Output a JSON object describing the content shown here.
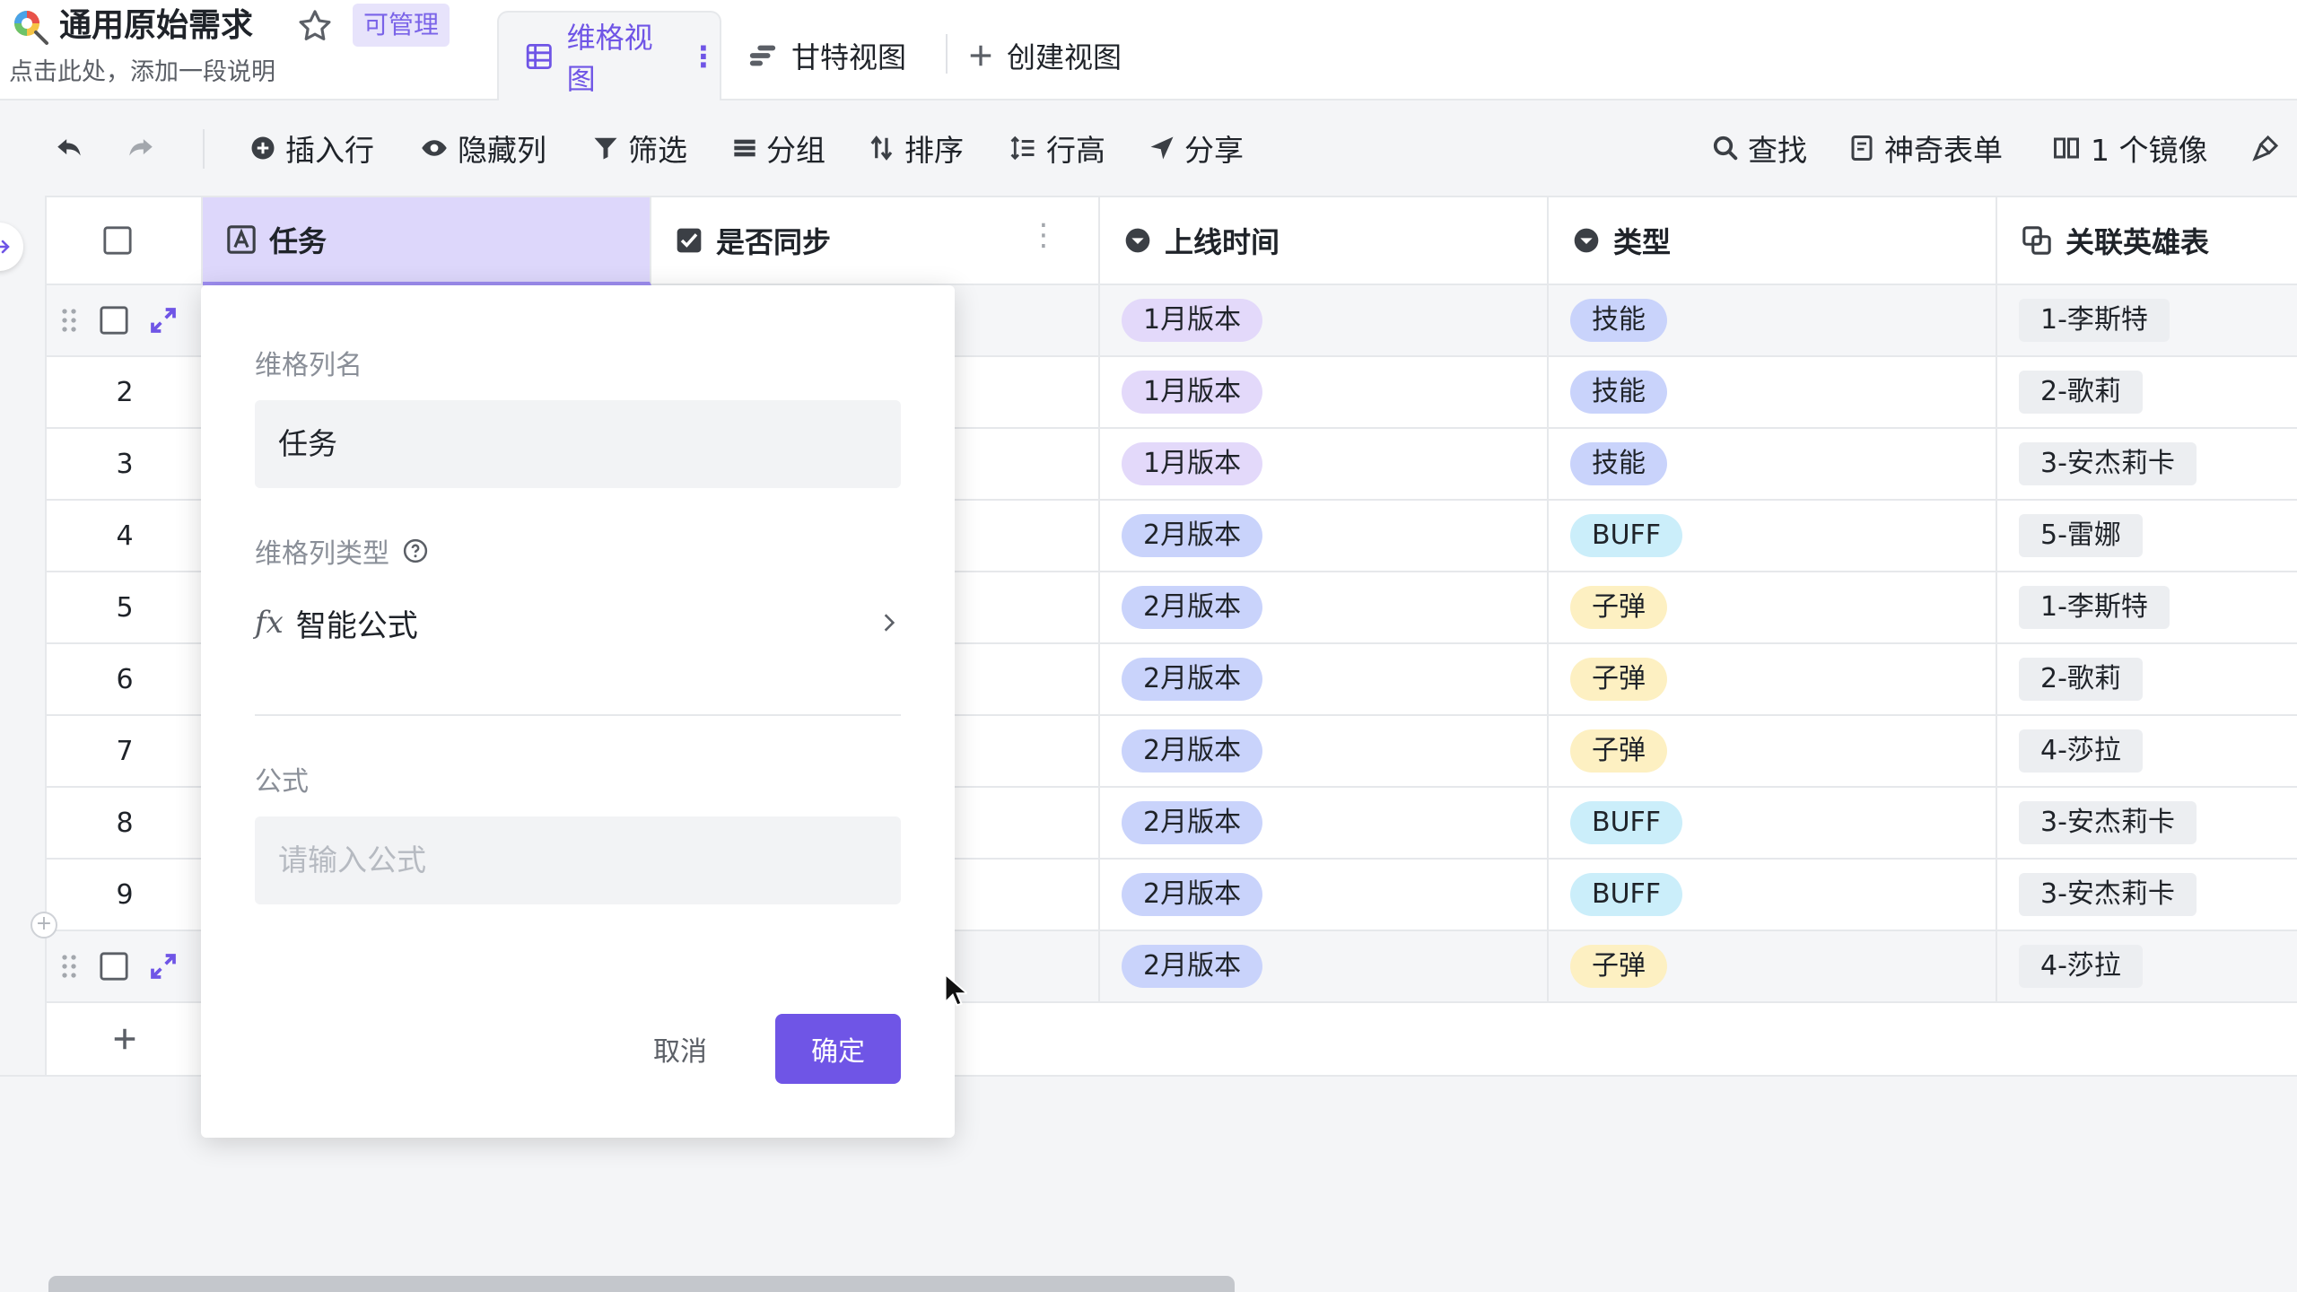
{
  "header": {
    "title": "通用原始需求",
    "permission": "可管理",
    "description": "点击此处，添加一段说明",
    "views": [
      {
        "label": "维格视图",
        "active": true
      },
      {
        "label": "甘特视图",
        "active": false
      },
      {
        "label": "创建视图",
        "active": false
      }
    ]
  },
  "toolbar": {
    "insert_row": "插入行",
    "hide_columns": "隐藏列",
    "filter": "筛选",
    "group": "分组",
    "sort": "排序",
    "row_height": "行高",
    "share": "分享",
    "find": "查找",
    "magic_form": "神奇表单",
    "mirror": "1 个镜像"
  },
  "columns": [
    {
      "name": "任务",
      "icon": "text-icon"
    },
    {
      "name": "是否同步",
      "icon": "checkbox-icon"
    },
    {
      "name": "上线时间",
      "icon": "single-select-icon"
    },
    {
      "name": "类型",
      "icon": "single-select-icon"
    },
    {
      "name": "关联英雄表",
      "icon": "link-icon"
    }
  ],
  "rows": [
    {
      "num": "",
      "release": "1月版本",
      "type": "技能",
      "hero": "1-李斯特"
    },
    {
      "num": "2",
      "release": "1月版本",
      "type": "技能",
      "hero": "2-歌莉"
    },
    {
      "num": "3",
      "release": "1月版本",
      "type": "技能",
      "hero": "3-安杰莉卡"
    },
    {
      "num": "4",
      "release": "2月版本",
      "type": "BUFF",
      "hero": "5-雷娜"
    },
    {
      "num": "5",
      "release": "2月版本",
      "type": "子弹",
      "hero": "1-李斯特"
    },
    {
      "num": "6",
      "release": "2月版本",
      "type": "子弹",
      "hero": "2-歌莉"
    },
    {
      "num": "7",
      "release": "2月版本",
      "type": "子弹",
      "hero": "4-莎拉"
    },
    {
      "num": "8",
      "release": "2月版本",
      "type": "BUFF",
      "hero": "3-安杰莉卡"
    },
    {
      "num": "9",
      "release": "2月版本",
      "type": "BUFF",
      "hero": "3-安杰莉卡"
    },
    {
      "num": "",
      "release": "2月版本",
      "type": "子弹",
      "hero": "4-莎拉"
    }
  ],
  "tag_colors": {
    "1月版本": "#e3d9fa",
    "2月版本": "#c9d3fb",
    "技能": "#c9d3fb",
    "BUFF": "#cbeefa",
    "子弹": "#fdf0c2"
  },
  "popup": {
    "name_label": "维格列名",
    "name_value": "任务",
    "type_label": "维格列类型",
    "type_value": "智能公式",
    "formula_label": "公式",
    "formula_placeholder": "请输入公式",
    "cancel": "取消",
    "confirm": "确定"
  },
  "colors": {
    "accent": "#6f55e6",
    "selected_header": "#ddd7fb"
  }
}
